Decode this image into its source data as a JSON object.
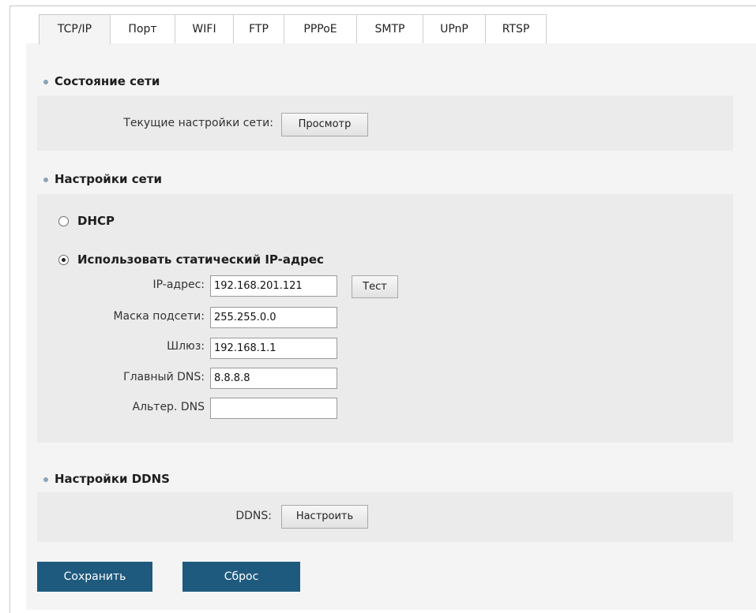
{
  "tabs": [
    {
      "label": "TCP/IP",
      "active": true
    },
    {
      "label": "Порт",
      "active": false
    },
    {
      "label": "WIFI",
      "active": false
    },
    {
      "label": "FTP",
      "active": false
    },
    {
      "label": "PPPoE",
      "active": false
    },
    {
      "label": "SMTP",
      "active": false
    },
    {
      "label": "UPnP",
      "active": false
    },
    {
      "label": "RTSP",
      "active": false
    }
  ],
  "network_status": {
    "title": "Состояние сети",
    "current_label": "Текущие настройки сети:",
    "view_button": "Просмотр"
  },
  "network_settings": {
    "title": "Настройки сети",
    "dhcp_label": "DHCP",
    "dhcp_selected": false,
    "static_label": "Использовать статический IP-адрес",
    "static_selected": true,
    "ip_label": "IP-адрес:",
    "ip_value": "192.168.201.121",
    "test_button": "Тест",
    "mask_label": "Маска подсети:",
    "mask_value": "255.255.0.0",
    "gateway_label": "Шлюз:",
    "gateway_value": "192.168.1.1",
    "dns1_label": "Главный DNS:",
    "dns1_value": "8.8.8.8",
    "dns2_label": "Альтер. DNS",
    "dns2_value": ""
  },
  "ddns": {
    "title": "Настройки DDNS",
    "label": "DDNS:",
    "configure_button": "Настроить"
  },
  "actions": {
    "save_label": "Сохранить",
    "reset_label": "Сброс"
  },
  "colors": {
    "accent": "#1e5a7e",
    "panel": "#ebebeb",
    "background": "#f4f4f4",
    "bullet": "#8aa4b8"
  }
}
